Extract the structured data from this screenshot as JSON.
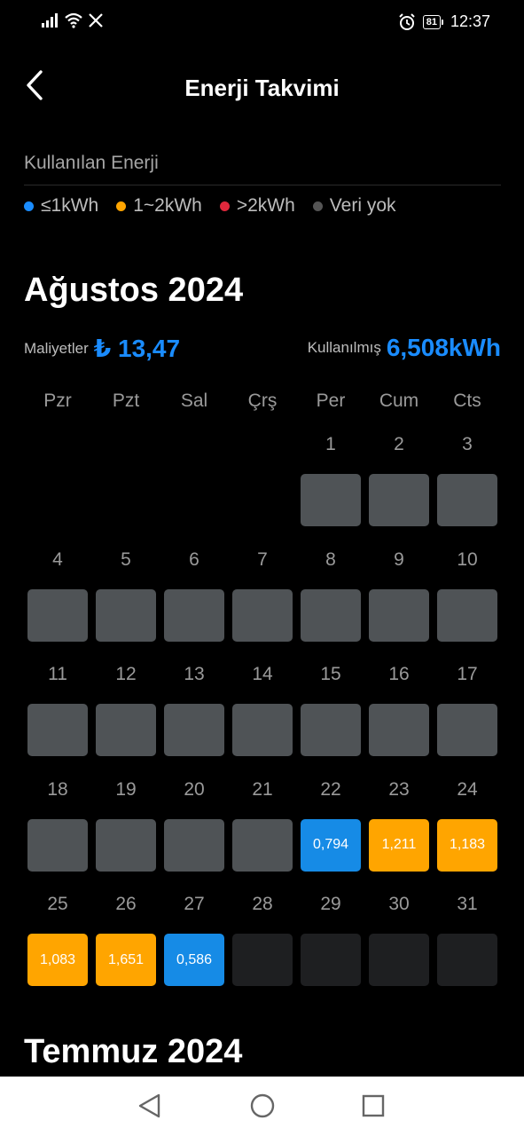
{
  "status_bar": {
    "time": "12:37",
    "battery": "81",
    "icons": [
      "signal-icon",
      "wifi-icon",
      "x-app-icon",
      "alarm-icon",
      "battery-icon"
    ]
  },
  "header": {
    "title": "Enerji Takvimi",
    "back_icon": "chevron-left-icon"
  },
  "legend": {
    "title": "Kullanılan Enerji",
    "items": [
      {
        "label": "≤1kWh",
        "color": "#1a8cff"
      },
      {
        "label": "1~2kWh",
        "color": "#ffa500"
      },
      {
        "label": ">2kWh",
        "color": "#e0283c"
      },
      {
        "label": "Veri yok",
        "color": "#555555"
      }
    ]
  },
  "colors": {
    "low": "#168be6",
    "mid": "#ffa500",
    "high": "#e0283c",
    "no_data": "#4f5356",
    "future": "#1e1f21"
  },
  "months": [
    {
      "title": "Ağustos 2024",
      "cost_label": "Maliyetler",
      "cost_value": "₺ 13,47",
      "used_label": "Kullanılmış",
      "used_value": "6,508kWh",
      "weekdays": [
        "Pzr",
        "Pzt",
        "Sal",
        "Çrş",
        "Per",
        "Cum",
        "Cts"
      ],
      "first_weekday_index": 4,
      "days": [
        {
          "day": "1",
          "value": "",
          "level": "no_data"
        },
        {
          "day": "2",
          "value": "",
          "level": "no_data"
        },
        {
          "day": "3",
          "value": "",
          "level": "no_data"
        },
        {
          "day": "4",
          "value": "",
          "level": "no_data"
        },
        {
          "day": "5",
          "value": "",
          "level": "no_data"
        },
        {
          "day": "6",
          "value": "",
          "level": "no_data"
        },
        {
          "day": "7",
          "value": "",
          "level": "no_data"
        },
        {
          "day": "8",
          "value": "",
          "level": "no_data"
        },
        {
          "day": "9",
          "value": "",
          "level": "no_data"
        },
        {
          "day": "10",
          "value": "",
          "level": "no_data"
        },
        {
          "day": "11",
          "value": "",
          "level": "no_data"
        },
        {
          "day": "12",
          "value": "",
          "level": "no_data"
        },
        {
          "day": "13",
          "value": "",
          "level": "no_data"
        },
        {
          "day": "14",
          "value": "",
          "level": "no_data"
        },
        {
          "day": "15",
          "value": "",
          "level": "no_data"
        },
        {
          "day": "16",
          "value": "",
          "level": "no_data"
        },
        {
          "day": "17",
          "value": "",
          "level": "no_data"
        },
        {
          "day": "18",
          "value": "",
          "level": "no_data"
        },
        {
          "day": "19",
          "value": "",
          "level": "no_data"
        },
        {
          "day": "20",
          "value": "",
          "level": "no_data"
        },
        {
          "day": "21",
          "value": "",
          "level": "no_data"
        },
        {
          "day": "22",
          "value": "0,794",
          "level": "low"
        },
        {
          "day": "23",
          "value": "1,211",
          "level": "mid"
        },
        {
          "day": "24",
          "value": "1,183",
          "level": "mid"
        },
        {
          "day": "25",
          "value": "1,083",
          "level": "mid"
        },
        {
          "day": "26",
          "value": "1,651",
          "level": "mid"
        },
        {
          "day": "27",
          "value": "0,586",
          "level": "low"
        },
        {
          "day": "28",
          "value": "",
          "level": "future"
        },
        {
          "day": "29",
          "value": "",
          "level": "future"
        },
        {
          "day": "30",
          "value": "",
          "level": "future"
        },
        {
          "day": "31",
          "value": "",
          "level": "future"
        }
      ]
    },
    {
      "title": "Temmuz 2024"
    }
  ],
  "nav_bar": {
    "icons": [
      "back-triangle-icon",
      "home-circle-icon",
      "recents-square-icon"
    ]
  }
}
